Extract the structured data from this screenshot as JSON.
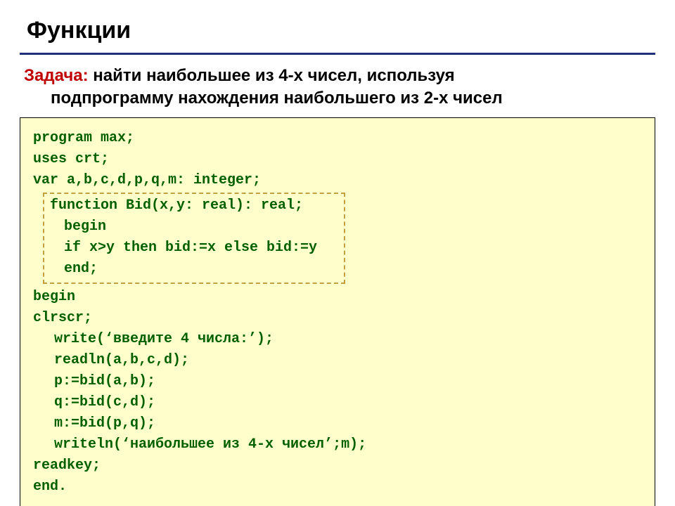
{
  "title": "Функции",
  "task": {
    "label": "Задача:",
    "line1_rest": " найти наибольшее из 4-х чисел, используя",
    "line2": "подпрограмму нахождения наибольшего из 2-х чисел"
  },
  "code": {
    "l1": "program max;",
    "l2": "uses crt;",
    "l3": "var a,b,c,d,p,q,m: integer;",
    "fn1": "function Bid(x,y: real): real;",
    "fn2": "begin",
    "fn3": "if x>y then bid:=x else bid:=y",
    "fn4": "end;",
    "l4": "begin",
    "l5": "clrscr;",
    "l6": "write(‘введите 4 числа:’);",
    "l7": "readln(a,b,c,d);",
    "l8": "p:=bid(a,b);",
    "l9": "q:=bid(c,d);",
    "l10": "m:=bid(p,q);",
    "l11": "writeln(‘наибольшее из 4-х чисел’;m);",
    "l12": "readkey;",
    "l13": "end."
  }
}
